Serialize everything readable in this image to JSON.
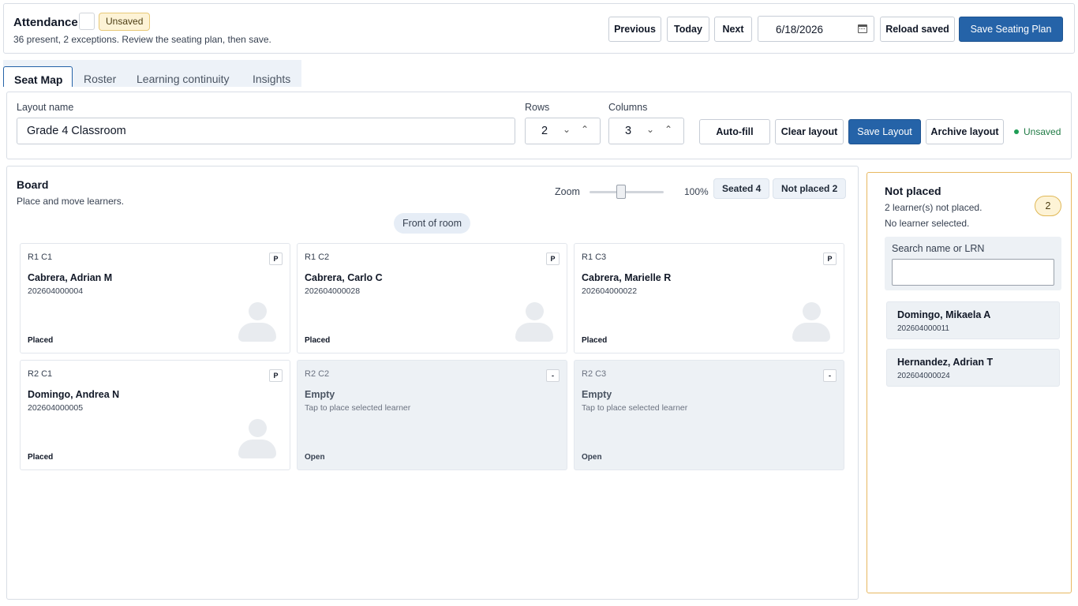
{
  "header": {
    "title": "Attendance",
    "badge": "Unsaved",
    "subtitle": "36 present, 2 exceptions. Review the seating plan, then save.",
    "buttons": {
      "previous": "Previous",
      "today": "Today",
      "next": "Next",
      "reload": "Reload saved",
      "save": "Save Seating Plan"
    },
    "date": "6/18/2026"
  },
  "tabs": [
    "Seat Map",
    "Roster",
    "Learning continuity",
    "Insights"
  ],
  "active_tab": "Seat Map",
  "layout": {
    "name_label": "Layout name",
    "name_value": "Grade 4 Classroom",
    "rows_label": "Rows",
    "rows_value": "2",
    "columns_label": "Columns",
    "columns_value": "3",
    "buttons": {
      "autofill": "Auto-fill",
      "clear": "Clear layout",
      "save": "Save Layout",
      "archive": "Archive layout"
    },
    "status": "Unsaved"
  },
  "board": {
    "title": "Board",
    "subtitle": "Place and move learners.",
    "zoom_label": "Zoom",
    "zoom_value": "100%",
    "zoom_level": 1.0,
    "seated": "Seated 4",
    "not_placed": "Not placed 2",
    "front": "Front of room",
    "seats": [
      {
        "pos": "R1 C1",
        "tag": "P",
        "name": "Cabrera, Adrian M",
        "lrn": "202604000004",
        "status": "Placed",
        "empty": false
      },
      {
        "pos": "R1 C2",
        "tag": "P",
        "name": "Cabrera, Carlo C",
        "lrn": "202604000028",
        "status": "Placed",
        "empty": false
      },
      {
        "pos": "R1 C3",
        "tag": "P",
        "name": "Cabrera, Marielle R",
        "lrn": "202604000022",
        "status": "Placed",
        "empty": false
      },
      {
        "pos": "R2 C1",
        "tag": "P",
        "name": "Domingo, Andrea N",
        "lrn": "202604000005",
        "status": "Placed",
        "empty": false
      },
      {
        "pos": "R2 C2",
        "tag": "-",
        "name": "Empty",
        "lrn": "Tap to place selected learner",
        "status": "Open",
        "empty": true
      },
      {
        "pos": "R2 C3",
        "tag": "-",
        "name": "Empty",
        "lrn": "Tap to place selected learner",
        "status": "Open",
        "empty": true
      }
    ]
  },
  "not_placed": {
    "title": "Not placed",
    "count": "2",
    "line1": "2 learner(s) not placed.",
    "line2": "No learner selected.",
    "search_label": "Search name or LRN",
    "search_placeholder": "",
    "learners": [
      {
        "name": "Domingo, Mikaela A",
        "lrn": "202604000011"
      },
      {
        "name": "Hernandez, Adrian T",
        "lrn": "202604000024"
      }
    ]
  }
}
